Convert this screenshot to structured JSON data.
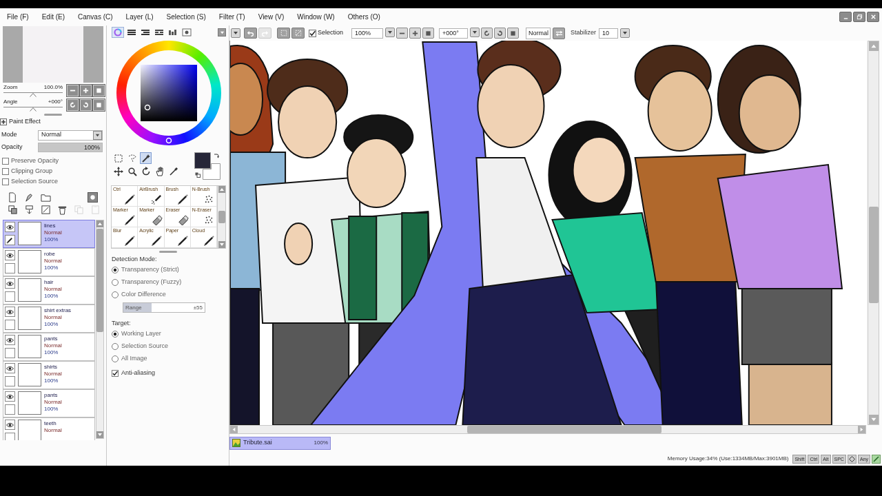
{
  "menu": [
    "File (F)",
    "Edit (E)",
    "Canvas (C)",
    "Layer (L)",
    "Selection (S)",
    "Filter (T)",
    "View (V)",
    "Window (W)",
    "Others (O)"
  ],
  "navigator": {
    "zoom": {
      "label": "Zoom",
      "value": "100.0%",
      "level": 0.5
    },
    "angle": {
      "label": "Angle",
      "value": "+000°",
      "level": 0.5
    }
  },
  "paint_effect": {
    "title": "Paint Effect",
    "mode_label": "Mode",
    "mode": "Normal",
    "opacity_label": "Opacity",
    "opacity": "100%",
    "level": 1,
    "options": [
      {
        "label": "Preserve Opacity",
        "checked": false
      },
      {
        "label": "Clipping Group",
        "checked": false
      },
      {
        "label": "Selection Source",
        "checked": false
      }
    ]
  },
  "layer_actions": {
    "top": [
      {
        "kind": "new",
        "disabled": false
      },
      {
        "kind": "linework",
        "disabled": false
      },
      {
        "kind": "folder",
        "disabled": false
      }
    ],
    "bottom": [
      {
        "kind": "transfer",
        "disabled": false
      },
      {
        "kind": "merge",
        "disabled": false
      },
      {
        "kind": "clear",
        "disabled": false
      },
      {
        "kind": "delete",
        "disabled": false
      },
      {
        "kind": "copy",
        "disabled": true
      },
      {
        "kind": "paste",
        "disabled": true
      }
    ]
  },
  "layers": [
    {
      "name": "lines",
      "mode": "Normal",
      "opacity": "100%",
      "visible": true,
      "selected": true
    },
    {
      "name": "robe",
      "mode": "Normal",
      "opacity": "100%",
      "visible": true,
      "selected": false
    },
    {
      "name": "hair",
      "mode": "Normal",
      "opacity": "100%",
      "visible": true,
      "selected": false
    },
    {
      "name": "shirt extras",
      "mode": "Normal",
      "opacity": "100%",
      "visible": true,
      "selected": false
    },
    {
      "name": "pants",
      "mode": "Normal",
      "opacity": "100%",
      "visible": true,
      "selected": false
    },
    {
      "name": "shirts",
      "mode": "Normal",
      "opacity": "100%",
      "visible": true,
      "selected": false
    },
    {
      "name": "pants",
      "mode": "Normal",
      "opacity": "100%",
      "visible": true,
      "selected": false
    },
    {
      "name": "teeth",
      "mode": "Normal",
      "visible": true,
      "selected": false
    }
  ],
  "color_tabs": [
    {
      "kind": "wheel",
      "selected": true
    },
    {
      "kind": "rgb",
      "selected": false
    },
    {
      "kind": "hsv",
      "selected": false
    },
    {
      "kind": "gradient",
      "selected": false
    },
    {
      "kind": "swatches",
      "selected": false
    },
    {
      "kind": "scratchpad",
      "selected": false
    }
  ],
  "tools": [
    {
      "kind": "marquee",
      "selected": false
    },
    {
      "kind": "lasso",
      "selected": false
    },
    {
      "kind": "wand",
      "selected": true
    },
    {
      "kind": "move",
      "selected": false
    },
    {
      "kind": "zoom",
      "selected": false
    },
    {
      "kind": "rotate",
      "selected": false
    },
    {
      "kind": "hand",
      "selected": false
    },
    {
      "kind": "dropper",
      "selected": false
    }
  ],
  "brushes": [
    {
      "name": "Ctrl",
      "kind": "pen"
    },
    {
      "name": "AirBrush",
      "kind": "spray"
    },
    {
      "name": "Brush",
      "kind": "pen"
    },
    {
      "name": "N-Brush",
      "kind": "noise"
    },
    {
      "name": "Marker",
      "kind": "pen"
    },
    {
      "name": "Marker",
      "kind": "eraser"
    },
    {
      "name": "Eraser",
      "kind": "eraser"
    },
    {
      "name": "N-Eraser",
      "kind": "noise"
    },
    {
      "name": "Blur",
      "kind": "pen"
    },
    {
      "name": "Acrylic",
      "kind": "pen"
    },
    {
      "name": "Paper",
      "kind": "pen"
    },
    {
      "name": "Cloud",
      "kind": "pen"
    }
  ],
  "detection": {
    "title": "Detection Mode:",
    "options": [
      {
        "label": "Transparency (Strict)",
        "selected": true
      },
      {
        "label": "Transparency (Fuzzy)",
        "selected": false
      },
      {
        "label": "Color Difference",
        "selected": false
      }
    ],
    "range": {
      "label": "Range",
      "value": "±55",
      "level": 0.35
    }
  },
  "target": {
    "title": "Target:",
    "options": [
      {
        "label": "Working Layer",
        "selected": true
      },
      {
        "label": "Selection Source",
        "selected": false
      },
      {
        "label": "All Image",
        "selected": false
      }
    ]
  },
  "anti_aliasing": {
    "label": "Anti-aliasing",
    "checked": true
  },
  "toolbar": {
    "history": [
      {
        "kind": "undo",
        "disabled": false
      },
      {
        "kind": "redo",
        "disabled": true
      }
    ],
    "selection": {
      "label": "Selection",
      "checked": true
    },
    "zoom": "100%",
    "angle": "+000°",
    "blend_mode": "Normal",
    "stabilizer_label": "Stabilizer",
    "stabilizer": "10"
  },
  "document_tab": {
    "name": "Tribute.sai",
    "zoom": "100%",
    "selected": true
  },
  "status_bar": {
    "memory": "Memory Usage:34% (Use:1334MB/Max:3901MB)",
    "keys": [
      {
        "kind": "text",
        "label": "Shift"
      },
      {
        "kind": "text",
        "label": "Ctrl"
      },
      {
        "kind": "text",
        "label": "Alt"
      },
      {
        "kind": "text",
        "label": "SPC"
      },
      {
        "kind": "icon"
      },
      {
        "kind": "text",
        "label": "Any"
      }
    ]
  }
}
